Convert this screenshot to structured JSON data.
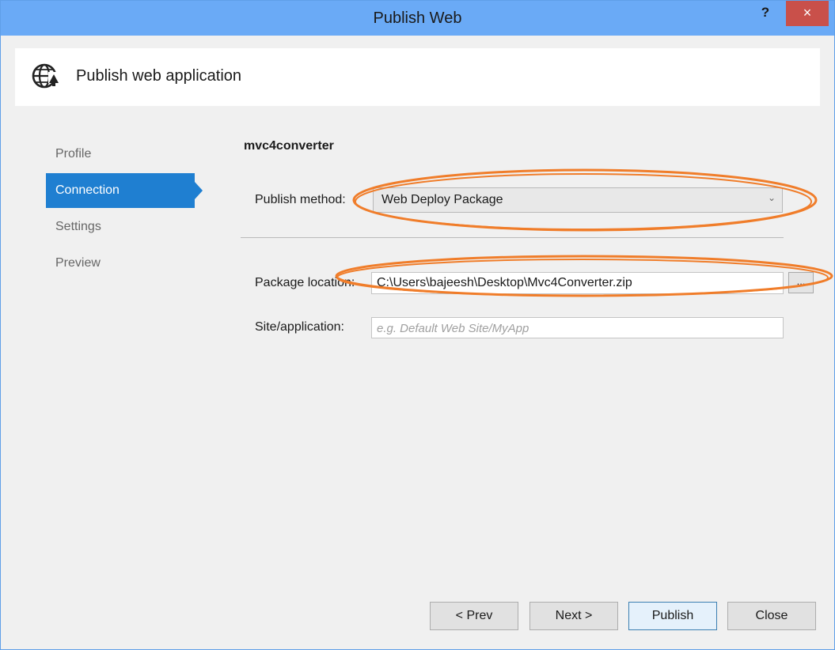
{
  "window": {
    "title": "Publish Web",
    "help_label": "?",
    "close_label": "×"
  },
  "header": {
    "title": "Publish web application",
    "icon": "globe-publish-icon"
  },
  "nav": {
    "items": [
      {
        "label": "Profile",
        "active": false
      },
      {
        "label": "Connection",
        "active": true
      },
      {
        "label": "Settings",
        "active": false
      },
      {
        "label": "Preview",
        "active": false
      }
    ]
  },
  "main": {
    "profile_name": "mvc4converter",
    "publish_method": {
      "label": "Publish method:",
      "value": "Web Deploy Package"
    },
    "package_location": {
      "label": "Package location:",
      "value": "C:\\Users\\bajeesh\\Desktop\\Mvc4Converter.zip",
      "browse_label": "..."
    },
    "site_application": {
      "label": "Site/application:",
      "value": "",
      "placeholder": "e.g. Default Web Site/MyApp"
    }
  },
  "footer": {
    "prev_label": "< Prev",
    "next_label": "Next >",
    "publish_label": "Publish",
    "close_label": "Close"
  },
  "colors": {
    "titlebar": "#6aaaf6",
    "close_button": "#c9504a",
    "nav_active": "#1f7fd1",
    "annotation": "#f07d2a"
  }
}
